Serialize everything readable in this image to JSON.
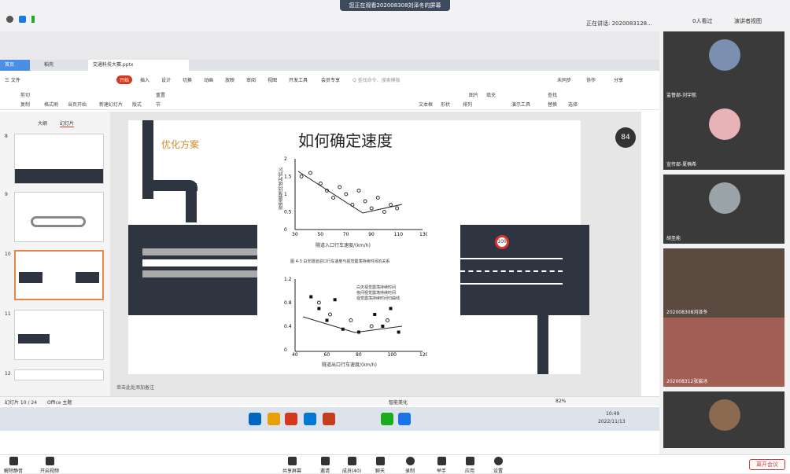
{
  "banner": "您正在观看2020083​08刘泽冬的屏幕",
  "speaking": "正在讲话: 2020083128...",
  "viewers": "0人看过",
  "presenter_view": "演讲者视图",
  "wps": {
    "tabs": {
      "home": "首页",
      "doc1": "稻壳",
      "doc2": "交通科技大赛.pptx"
    },
    "menu": [
      "三 文件",
      "开始",
      "插入",
      "设计",
      "切换",
      "动画",
      "放映",
      "审阅",
      "视图",
      "开发工具",
      "会员专享"
    ],
    "search": "Q 查找命令、搜索模板",
    "right_menu": [
      "未同步",
      "协作",
      "分享"
    ],
    "ribbon": [
      "剪切",
      "复制",
      "格式刷",
      "当页开始",
      "新建幻灯片",
      "版式",
      "节",
      "重置",
      "文本框",
      "形状",
      "排列",
      "图片",
      "填充",
      "演示工具",
      "查找",
      "替换",
      "选择"
    ],
    "panel_tabs": [
      "大纲",
      "幻灯片"
    ],
    "thumbs": [
      {
        "num": "8"
      },
      {
        "num": "9"
      },
      {
        "num": "10"
      },
      {
        "num": "11"
      },
      {
        "num": "12"
      }
    ],
    "slide": {
      "tag": "优化方案",
      "title": "如何确定速度",
      "caption": "图 4-3 白天隧道进口行车速度与视觉震荡持续时间的关系",
      "chart1_y": "视觉震荡持续时间/s",
      "chart1_x": "隧道入口行车速度/(km/h)",
      "chart2_y": "视觉震荡持续时间/s",
      "chart2_x": "隧道出口行车速度/(km/h)",
      "legend": [
        "白天视觉震荡持续时间",
        "夜间视觉震荡持续时间",
        "视觉震荡持续时间归曲线"
      ],
      "speed_sign": "100",
      "badge": "84"
    },
    "notes": "单击此处添加备注",
    "status": "幻灯片 10 / 24",
    "status2": "Office 主题",
    "status_right": "智能美化",
    "zoom": "82%",
    "clock": "10:49",
    "date": "2022/11/13"
  },
  "chart_data": [
    {
      "type": "scatter",
      "title": "",
      "xlabel": "隧道入口行车速度/(km/h)",
      "ylabel": "视觉震荡持续时间/s",
      "x_ticks": [
        30,
        50,
        70,
        90,
        110,
        130
      ],
      "y_ticks": [
        0,
        0.5,
        1.0,
        1.5,
        2.0
      ],
      "series": [
        {
          "name": "",
          "points": [
            [
              35,
              1.5
            ],
            [
              42,
              1.6
            ],
            [
              50,
              1.3
            ],
            [
              55,
              1.1
            ],
            [
              60,
              0.9
            ],
            [
              65,
              1.2
            ],
            [
              70,
              1.0
            ],
            [
              75,
              0.7
            ],
            [
              80,
              1.1
            ],
            [
              85,
              0.8
            ],
            [
              90,
              0.6
            ],
            [
              95,
              0.9
            ],
            [
              100,
              0.5
            ],
            [
              105,
              0.7
            ],
            [
              110,
              0.6
            ]
          ]
        }
      ]
    },
    {
      "type": "scatter",
      "title": "",
      "xlabel": "隧道出口行车速度/(km/h)",
      "ylabel": "视觉震荡持续时间/s",
      "x_ticks": [
        40,
        60,
        80,
        100,
        120
      ],
      "y_ticks": [
        0,
        0.4,
        0.8,
        1.2
      ],
      "series": [
        {
          "name": "白天视觉震荡持续时间",
          "points": [
            [
              50,
              0.9
            ],
            [
              55,
              0.7
            ],
            [
              60,
              0.5
            ],
            [
              65,
              0.85
            ],
            [
              70,
              0.35
            ],
            [
              80,
              0.3
            ],
            [
              90,
              0.6
            ],
            [
              95,
              0.4
            ],
            [
              100,
              0.7
            ],
            [
              105,
              0.3
            ]
          ]
        },
        {
          "name": "夜间视觉震荡持续时间",
          "points": [
            [
              55,
              0.8
            ],
            [
              62,
              0.6
            ],
            [
              75,
              0.5
            ],
            [
              88,
              0.4
            ],
            [
              98,
              0.5
            ]
          ]
        }
      ]
    }
  ],
  "participants": [
    "监督部-刘宇航",
    "宣传部-夏楠希",
    "胡圣能",
    "202008308刘泽冬",
    "202008312张宸冰"
  ],
  "bottom": {
    "mute": "解除静音",
    "video": "开启视频",
    "share": "共享屏幕",
    "invite": "邀请",
    "members": "成员(40)",
    "chat": "聊天",
    "record": "录制",
    "hand": "举手",
    "apps": "应用",
    "settings": "设置",
    "leave": "离开会议"
  }
}
